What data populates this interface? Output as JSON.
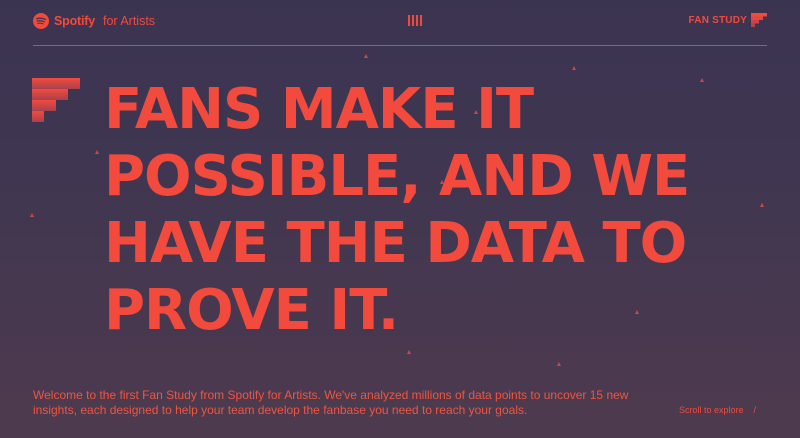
{
  "header": {
    "brand_name": "Spotify",
    "brand_suffix": "for Artists",
    "brand_icon": "spotify-logo-icon",
    "menu_icon": "menu-bars-icon",
    "study_label": "FAN STUDY",
    "study_icon": "fan-study-mark-icon"
  },
  "hero": {
    "headline_lines": [
      "FANS MAKE IT",
      "POSSIBLE, AND WE",
      "HAVE THE DATA TO",
      "PROVE IT."
    ],
    "side_icon": "stairs-mark-icon",
    "intro_text": "Welcome to the first Fan Study from Spotify for Artists. We've analyzed millions of data points to uncover 15 new insights, each designed to help your team develop the fanbase you need to reach your goals."
  },
  "footer": {
    "scroll_label": "Scroll to explore",
    "scroll_glyph": "/"
  },
  "colors": {
    "accent": "#f24a3d",
    "background_top": "#3b3451",
    "background_bottom": "#4e3a4f"
  }
}
